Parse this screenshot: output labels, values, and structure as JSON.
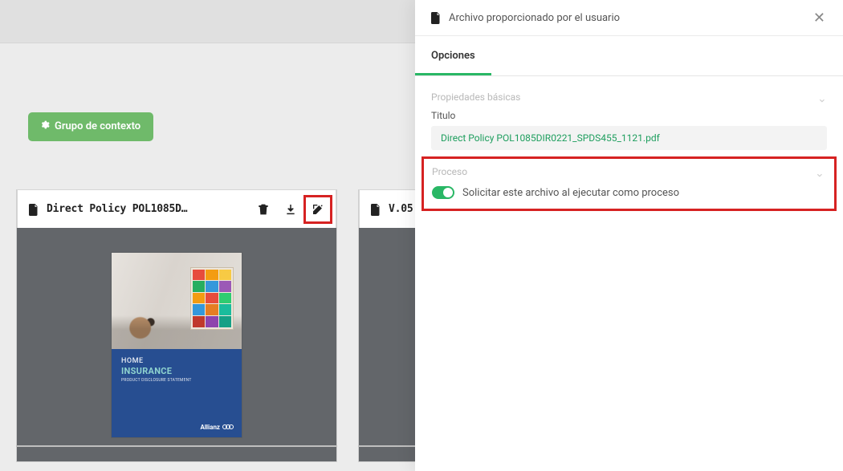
{
  "context_group_label": "Grupo de contexto",
  "cards": {
    "card1": {
      "title_short": "Direct Policy POL1085D…",
      "thumb": {
        "line1": "HOME",
        "line2": "INSURANCE",
        "line3": "PRODUCT DISCLOSURE STATEMENT",
        "brand": "Allianz"
      }
    },
    "card2": {
      "title_short": "V.05"
    }
  },
  "panel": {
    "header_title": "Archivo proporcionado por el usuario",
    "tabs": {
      "opciones": "Opciones"
    },
    "section_basic": "Propiedades básicas",
    "field_title_label": "Titulo",
    "field_title_value": "Direct Policy POL1085DIR0221_SPDS455_1121.pdf",
    "section_proceso": "Proceso",
    "toggle_label": "Solicitar este archivo al ejecutar como proceso",
    "toggle_on": true
  }
}
